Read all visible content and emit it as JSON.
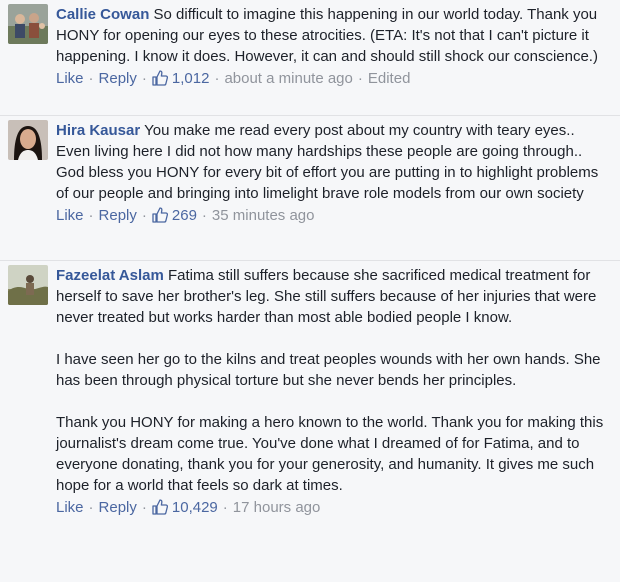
{
  "comments": [
    {
      "author": "Callie Cowan",
      "paragraphs": [
        "So difficult to imagine this happening in our world today. Thank you HONY for opening our eyes to these atrocities. (ETA: It's not that I can't picture it happening. I know it does. However, it can and should still shock our conscience.)"
      ],
      "like_label": "Like",
      "reply_label": "Reply",
      "likes": "1,012",
      "time": "about a minute ago",
      "edited": "Edited"
    },
    {
      "author": "Hira Kausar",
      "paragraphs": [
        "You make me read every post about my country with teary eyes.. Even living here I did not how many hardships these people are going through.. God bless you HONY for every bit of effort you are putting in to highlight problems of our people and bringing into limelight brave role models from our own society"
      ],
      "like_label": "Like",
      "reply_label": "Reply",
      "likes": "269",
      "time": "35 minutes ago"
    },
    {
      "author": "Fazeelat Aslam",
      "paragraphs": [
        "Fatima still suffers because she sacrificed medical treatment for herself to save her brother's leg. She still suffers because of her injuries that were never treated but works harder than most able bodied people I know.",
        "I have seen her go to the kilns and treat peoples wounds with her own hands. She has been through physical torture but she never bends her principles.",
        "Thank you HONY for making a hero known to the world. Thank you for making this journalist's dream come true. You've done what I dreamed of for Fatima, and to everyone donating, thank you for your generosity, and humanity. It gives me such hope for a world that feels so dark at times."
      ],
      "like_label": "Like",
      "reply_label": "Reply",
      "likes": "10,429",
      "time": "17 hours ago"
    }
  ],
  "separator": "·",
  "colors": {
    "link": "#4b67a1",
    "name": "#365899",
    "meta": "#90949c",
    "background": "#f6f7f9"
  },
  "icons": {
    "like": "thumbs-up-icon"
  }
}
